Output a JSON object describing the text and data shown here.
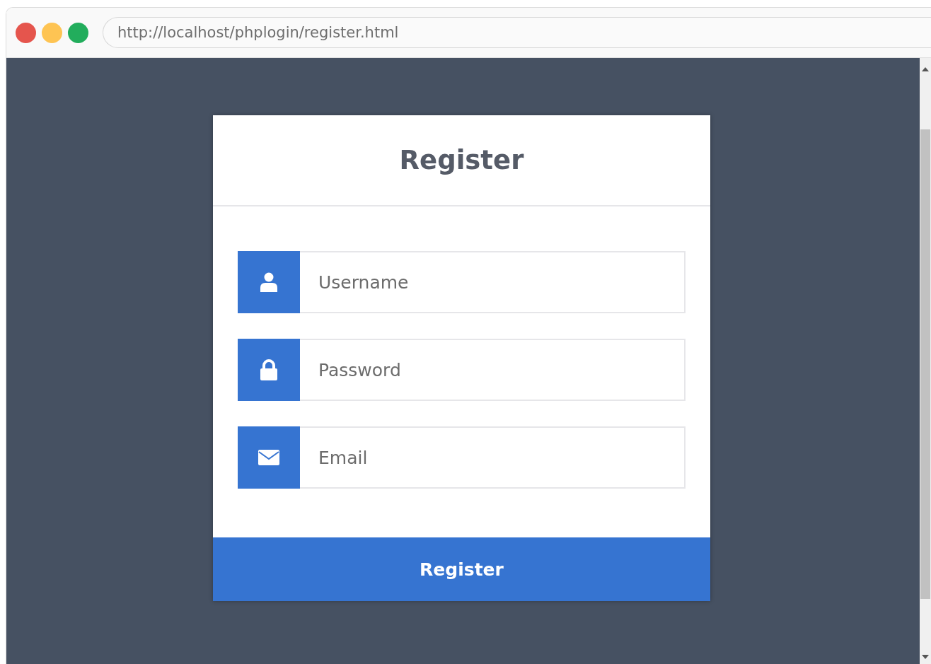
{
  "browser": {
    "address": "http://localhost/phplogin/register.html"
  },
  "form": {
    "title": "Register",
    "fields": [
      {
        "kind": "user",
        "placeholder": "Username"
      },
      {
        "kind": "lock",
        "placeholder": "Password"
      },
      {
        "kind": "mail",
        "placeholder": "Email"
      }
    ],
    "submit": "Register"
  }
}
